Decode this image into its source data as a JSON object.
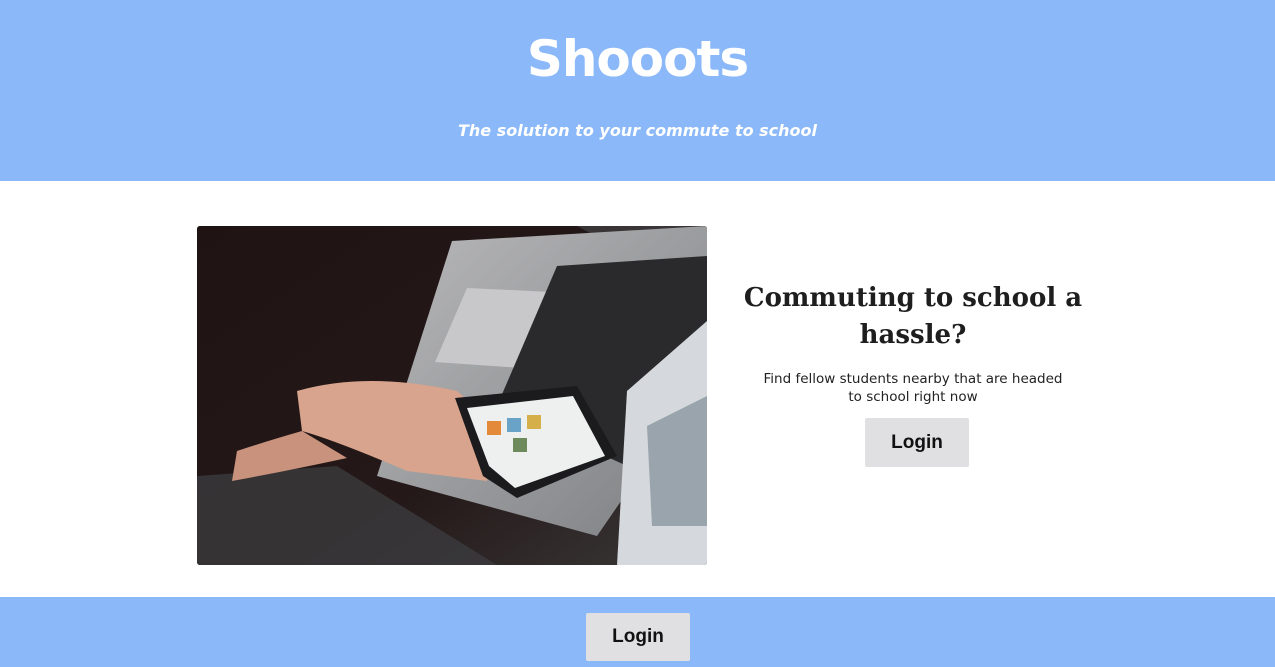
{
  "header": {
    "brand": "Shooots",
    "tagline": "The solution to your commute to school"
  },
  "hero": {
    "image_icon": "laptop-phone-photo",
    "heading_line1": "Commuting to school a",
    "heading_line2": "hassle?",
    "description": "Find fellow students nearby that are headed to school right now",
    "login_label": "Login"
  },
  "footer": {
    "login_label": "Login"
  },
  "colors": {
    "brand_blue": "#8bb8f8",
    "button_gray": "#e0e0e2"
  }
}
